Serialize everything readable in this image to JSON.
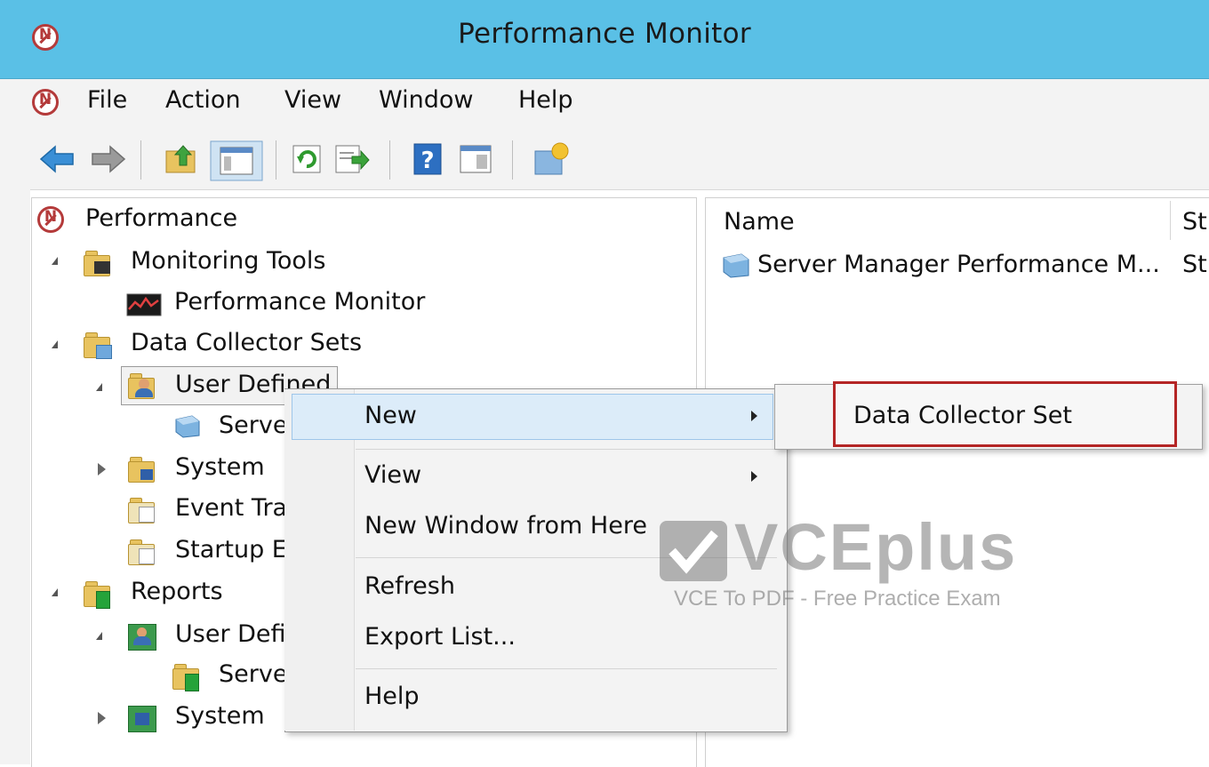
{
  "window": {
    "title": "Performance Monitor"
  },
  "menu": [
    "File",
    "Action",
    "View",
    "Window",
    "Help"
  ],
  "toolbar": {
    "icons": [
      "back-icon",
      "forward-icon",
      "up-folder-icon",
      "show-hide-tree-icon",
      "refresh-icon",
      "export-list-icon",
      "help-icon",
      "properties-icon",
      "new-window-icon"
    ]
  },
  "tree": {
    "root": "Performance",
    "monitoring_tools": "Monitoring Tools",
    "performance_monitor": "Performance Monitor",
    "data_collector_sets": "Data Collector Sets",
    "user_defined": "User Defined",
    "server": "Serve",
    "system": "System",
    "event_trace": "Event Tra",
    "startup_event": "Startup E",
    "reports": "Reports",
    "reports_user_defined": "User Defi",
    "reports_server": "Serve",
    "reports_system": "System"
  },
  "list": {
    "columns": [
      "Name",
      "St"
    ],
    "rows": [
      {
        "name": "Server Manager Performance M...",
        "status": "St"
      }
    ]
  },
  "context_menu": {
    "new": "New",
    "view": "View",
    "new_window": "New Window from Here",
    "refresh": "Refresh",
    "export_list": "Export List...",
    "help": "Help"
  },
  "submenu": {
    "data_collector_set": "Data Collector Set"
  },
  "watermark": {
    "big": "VCEplus",
    "small": "VCE To PDF - Free Practice Exam"
  },
  "colors": {
    "titlebar": "#5ac0e6",
    "highlight": "#dcecf9",
    "callout_border": "#b42525"
  }
}
